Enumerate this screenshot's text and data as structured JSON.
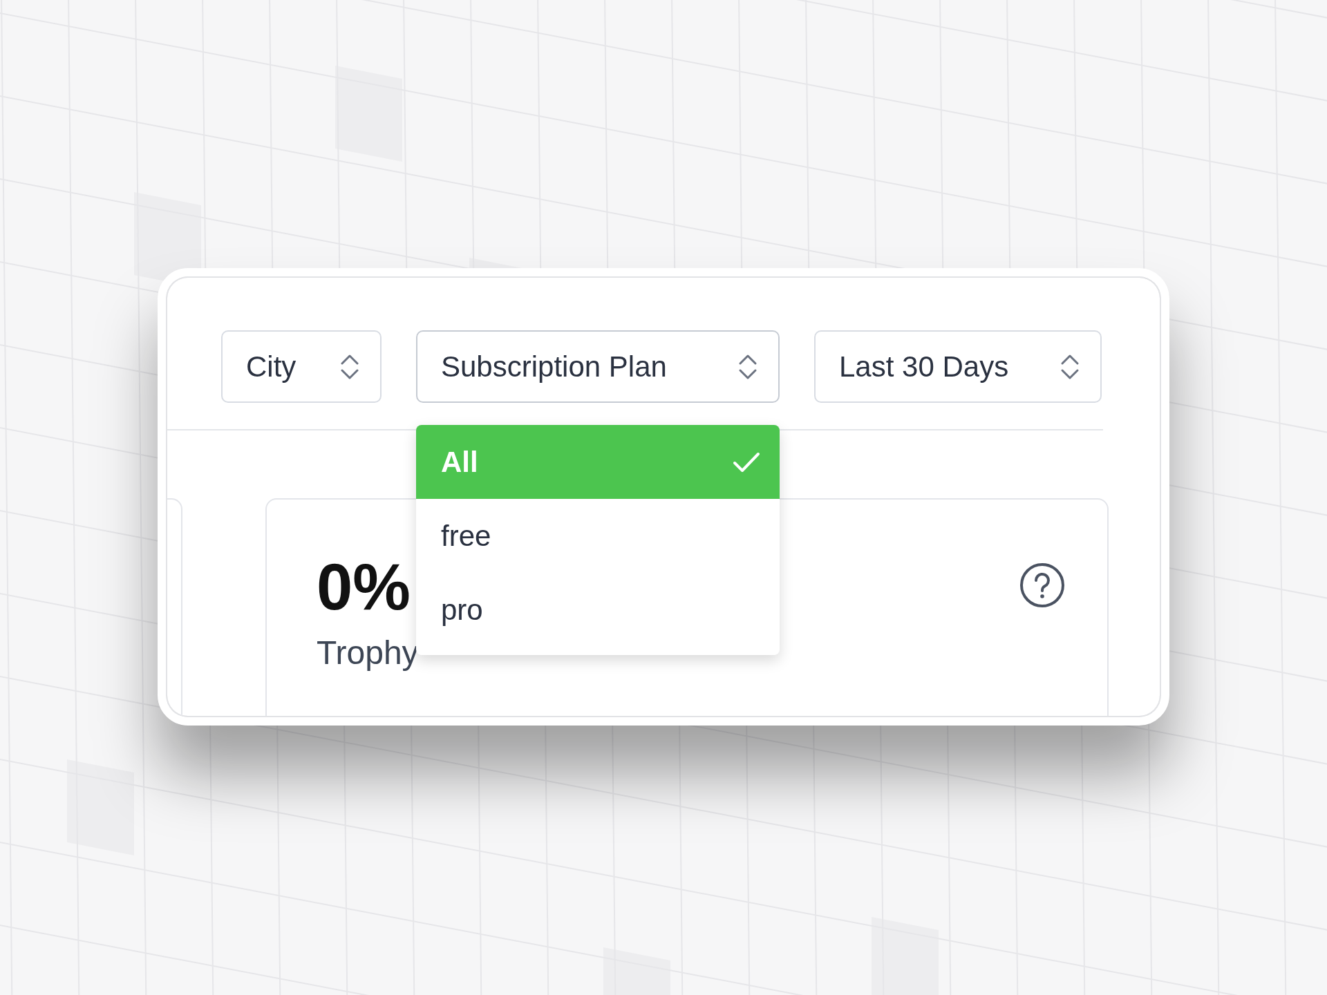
{
  "filters": [
    {
      "label": "City",
      "open": false
    },
    {
      "label": "Subscription Plan",
      "open": true,
      "options": [
        {
          "label": "All",
          "selected": true
        },
        {
          "label": "free",
          "selected": false
        },
        {
          "label": "pro",
          "selected": false
        }
      ]
    },
    {
      "label": "Last 30 Days",
      "open": false
    }
  ],
  "stat": {
    "value": "0%",
    "label": "Trophy"
  }
}
